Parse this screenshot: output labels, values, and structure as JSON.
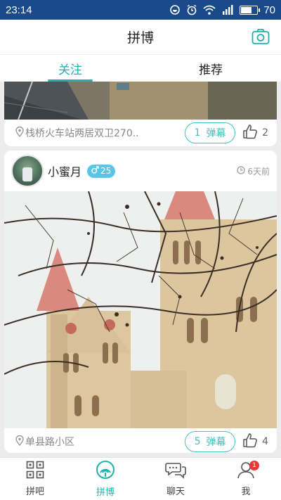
{
  "status_bar": {
    "time": "23:14",
    "battery": "70",
    "battery_level": 0.7
  },
  "header": {
    "title": "拼博",
    "camera_icon": "camera-icon"
  },
  "tabs": [
    {
      "label": "关注",
      "active": true
    },
    {
      "label": "推荐",
      "active": false
    }
  ],
  "posts": [
    {
      "location": "栈桥火车站两居双卫270..",
      "danmu_count": "1",
      "danmu_label": "弹幕",
      "likes": "2"
    },
    {
      "user": "小蜜月",
      "gender_age": "25",
      "time_ago": "6天前",
      "location": "单县路小区",
      "danmu_count": "5",
      "danmu_label": "弹幕",
      "likes": "4"
    }
  ],
  "bottom_nav": [
    {
      "label": "拼吧",
      "icon": "grid-icon"
    },
    {
      "label": "拼博",
      "icon": "signal-icon",
      "active": true
    },
    {
      "label": "聊天",
      "icon": "chat-icon"
    },
    {
      "label": "我",
      "icon": "profile-icon",
      "badge": "1"
    }
  ],
  "colors": {
    "accent": "#20b2aa",
    "status_bar": "#1a4a8a",
    "gender_badge": "#5bc5e8",
    "badge": "#e53935"
  }
}
